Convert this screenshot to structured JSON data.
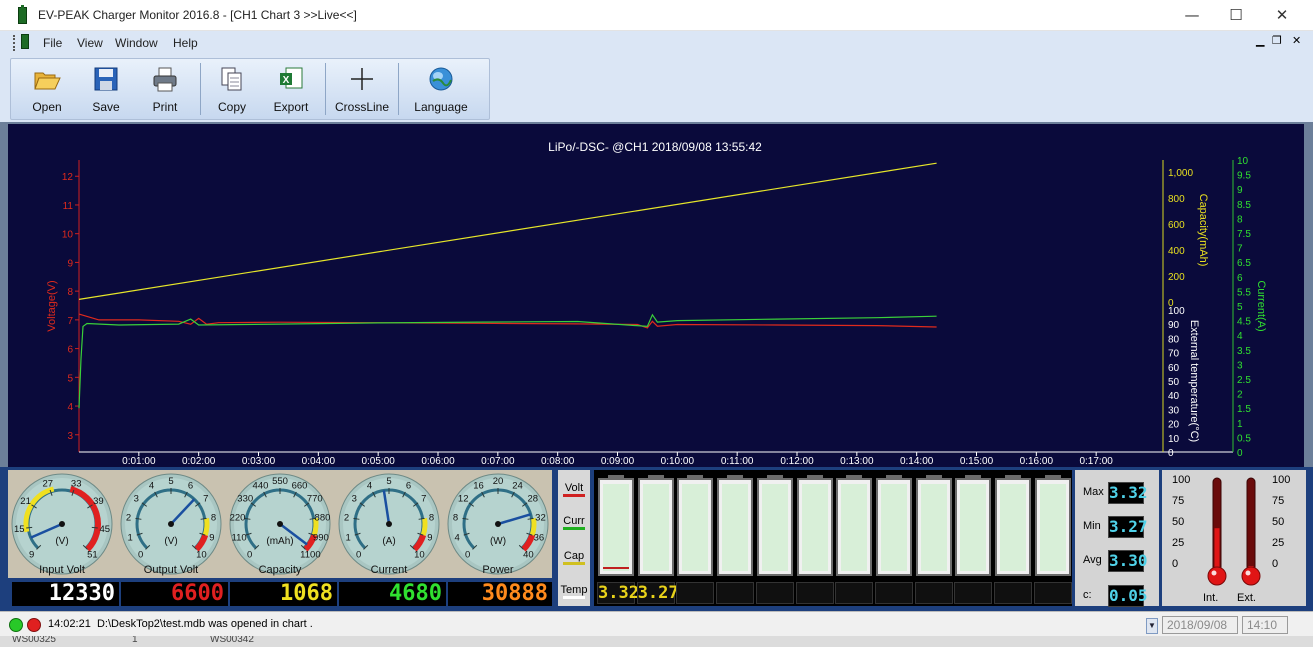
{
  "window": {
    "title": "EV-PEAK Charger Monitor 2016.8 - [CH1 Chart 3 >>Live<<]",
    "minimize": "—",
    "maximize": "☐",
    "close": "✕"
  },
  "menu": {
    "items": [
      "File",
      "View",
      "Window",
      "Help"
    ],
    "mdi_min": "▁",
    "mdi_restore": "❐",
    "mdi_close": "✕"
  },
  "toolbar": {
    "buttons": [
      {
        "label": "Open",
        "icon": "folder-open-icon"
      },
      {
        "label": "Save",
        "icon": "floppy-disk-icon"
      },
      {
        "label": "Print",
        "icon": "printer-icon"
      },
      {
        "label": "Copy",
        "icon": "copy-icon"
      },
      {
        "label": "Export",
        "icon": "excel-export-icon"
      },
      {
        "label": "CrossLine",
        "icon": "crosshair-icon"
      },
      {
        "label": "Language",
        "icon": "globe-icon"
      }
    ]
  },
  "chart_data": {
    "type": "line",
    "title": "LiPo/-DSC-    @CH1   2018/09/08   13:55:42",
    "x_ticks": [
      "0:01:00",
      "0:02:00",
      "0:03:00",
      "0:04:00",
      "0:05:00",
      "0:06:00",
      "0:07:00",
      "0:08:00",
      "0:09:00",
      "0:10:00",
      "0:11:00",
      "0:12:00",
      "0:13:00",
      "0:14:00",
      "0:15:00",
      "0:16:00",
      "0:17:00"
    ],
    "xlim_seconds": [
      0,
      1080
    ],
    "y_voltage": {
      "label": "Voltage(V)",
      "ticks": [
        "3",
        "4",
        "5",
        "6",
        "7",
        "8",
        "9",
        "10",
        "11",
        "12"
      ],
      "ylim": [
        2.4,
        12.6
      ],
      "color": "#e03020"
    },
    "y_capacity": {
      "label": "Capacity(mAh)",
      "ticks": [
        "0",
        "200",
        "400",
        "600",
        "800",
        "1,000"
      ],
      "ylim": [
        0,
        1100
      ],
      "color": "#e8e020"
    },
    "y_temperature": {
      "label": "External temperature(°C)",
      "ticks": [
        "0",
        "10",
        "20",
        "30",
        "40",
        "50",
        "60",
        "70",
        "80",
        "90",
        "100"
      ],
      "ylim": [
        0,
        100
      ],
      "color": "#ffffff"
    },
    "y_current": {
      "label": "Current(A)",
      "ticks": [
        "0",
        "0.5",
        "1",
        "1.5",
        "2",
        "2.5",
        "3",
        "3.5",
        "4",
        "4.5",
        "5",
        "5.5",
        "6",
        "6.5",
        "7",
        "7.5",
        "8",
        "8.5",
        "9",
        "9.5",
        "10"
      ],
      "ylim": [
        0,
        10
      ],
      "color": "#30e030"
    },
    "series": [
      {
        "name": "Voltage",
        "axis": "voltage",
        "color": "#e02a1c",
        "x": [
          0,
          20,
          60,
          100,
          112,
          120,
          128,
          140,
          200,
          300,
          400,
          500,
          560,
          570,
          575,
          580,
          600,
          700,
          800,
          860
        ],
        "y": [
          7.2,
          7.0,
          7.0,
          6.95,
          6.85,
          7.05,
          6.85,
          6.9,
          6.92,
          6.9,
          6.88,
          6.86,
          6.84,
          6.72,
          6.95,
          6.78,
          6.84,
          6.82,
          6.8,
          6.75
        ]
      },
      {
        "name": "Current",
        "axis": "current",
        "color": "#3ad03a",
        "x": [
          0,
          2,
          4,
          8,
          40,
          100,
          112,
          120,
          200,
          300,
          400,
          500,
          570,
          575,
          580,
          600,
          700,
          800,
          860
        ],
        "y": [
          1.5,
          3.2,
          4.3,
          4.4,
          4.35,
          4.38,
          4.55,
          4.35,
          4.38,
          4.42,
          4.45,
          4.47,
          4.3,
          4.7,
          4.45,
          4.5,
          4.55,
          4.6,
          4.65
        ]
      },
      {
        "name": "Capacity",
        "axis": "capacity",
        "color": "#e6e62a",
        "x": [
          0,
          860
        ],
        "y": [
          20,
          1068
        ]
      }
    ]
  },
  "gauges": [
    {
      "title": "Input Volt",
      "unit": "(V)",
      "ticks": [
        "9",
        "15",
        "21",
        "27",
        "33",
        "39",
        "45",
        "51"
      ],
      "value": 12.33,
      "min": 9,
      "max": 51
    },
    {
      "title": "Output Volt",
      "unit": "(V)",
      "ticks": [
        "0",
        "1",
        "2",
        "3",
        "4",
        "5",
        "6",
        "7",
        "8",
        "9",
        "10"
      ],
      "value": 6.6,
      "min": 0,
      "max": 10
    },
    {
      "title": "Capacity",
      "unit": "(mAh)",
      "ticks": [
        "0",
        "110",
        "220",
        "330",
        "440",
        "550",
        "660",
        "770",
        "880",
        "990",
        "1100"
      ],
      "value": 1068,
      "min": 0,
      "max": 1100
    },
    {
      "title": "Current",
      "unit": "(A)",
      "ticks": [
        "0",
        "1",
        "2",
        "3",
        "4",
        "5",
        "6",
        "7",
        "8",
        "9",
        "10"
      ],
      "value": 4.68,
      "min": 0,
      "max": 10
    },
    {
      "title": "Power",
      "unit": "(W)",
      "ticks": [
        "0",
        "4",
        "8",
        "12",
        "16",
        "20",
        "24",
        "28",
        "32",
        "36",
        "40"
      ],
      "value": 30.888,
      "min": 0,
      "max": 40
    }
  ],
  "lcd": [
    {
      "text": "12330",
      "color": "#ffffff"
    },
    {
      "text": "6600",
      "color": "#e02020"
    },
    {
      "text": "1068",
      "color": "#f0e020"
    },
    {
      "text": "4680",
      "color": "#30e030"
    },
    {
      "text": "30888",
      "color": "#ff8a1c"
    }
  ],
  "legend": [
    {
      "label": "Volt",
      "color": "#d02020"
    },
    {
      "label": "Curr",
      "color": "#20b020"
    },
    {
      "label": "Cap",
      "color": "#d0c020"
    },
    {
      "label": "Temp",
      "color": "#ffffff"
    }
  ],
  "cells": {
    "count": 12,
    "readings": [
      "3.32",
      "3.27"
    ]
  },
  "stats": [
    {
      "label": "Max",
      "value": "3.32"
    },
    {
      "label": "Min",
      "value": "3.27"
    },
    {
      "label": "Avg",
      "value": "3.30"
    },
    {
      "label": "c:",
      "value": "0.05"
    }
  ],
  "thermometers": {
    "ticks": [
      "100",
      "75",
      "50",
      "25",
      "0"
    ],
    "int": {
      "label": "Int.",
      "level": 0.45
    },
    "ext": {
      "label": "Ext.",
      "level": 0.0
    }
  },
  "status": {
    "time": "14:02:21",
    "message": "D:\\DeskTop2\\test.mdb was opened in chart .",
    "date": "2018/09/08",
    "clock": "14:10"
  },
  "strip": [
    "WS00325",
    "1",
    "WS00342"
  ]
}
